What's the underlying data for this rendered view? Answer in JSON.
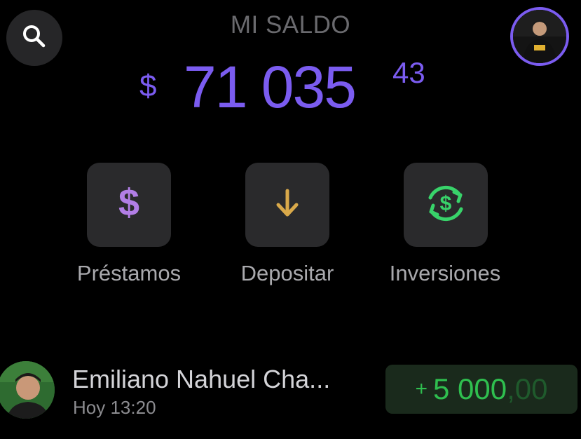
{
  "header": {
    "title": "MI SALDO",
    "search_icon": "search-icon"
  },
  "balance": {
    "currency": "$",
    "amount": "71 035",
    "cents": "43"
  },
  "actions": [
    {
      "label": "Préstamos",
      "icon": "dollar-icon",
      "color": "#b27ee6"
    },
    {
      "label": "Depositar",
      "icon": "arrow-down-icon",
      "color": "#d9a94a"
    },
    {
      "label": "Inversiones",
      "icon": "investment-cycle-icon",
      "color": "#38d36a"
    }
  ],
  "transactions": [
    {
      "name": "Emiliano Nahuel Cha...",
      "time": "Hoy 13:20",
      "amount_sign": "+",
      "amount_int": "5 000",
      "amount_dec": ",00"
    }
  ],
  "colors": {
    "accent": "#7b5cf0",
    "positive": "#2fbf4f",
    "background": "#000000",
    "tile": "#2a2a2c"
  }
}
